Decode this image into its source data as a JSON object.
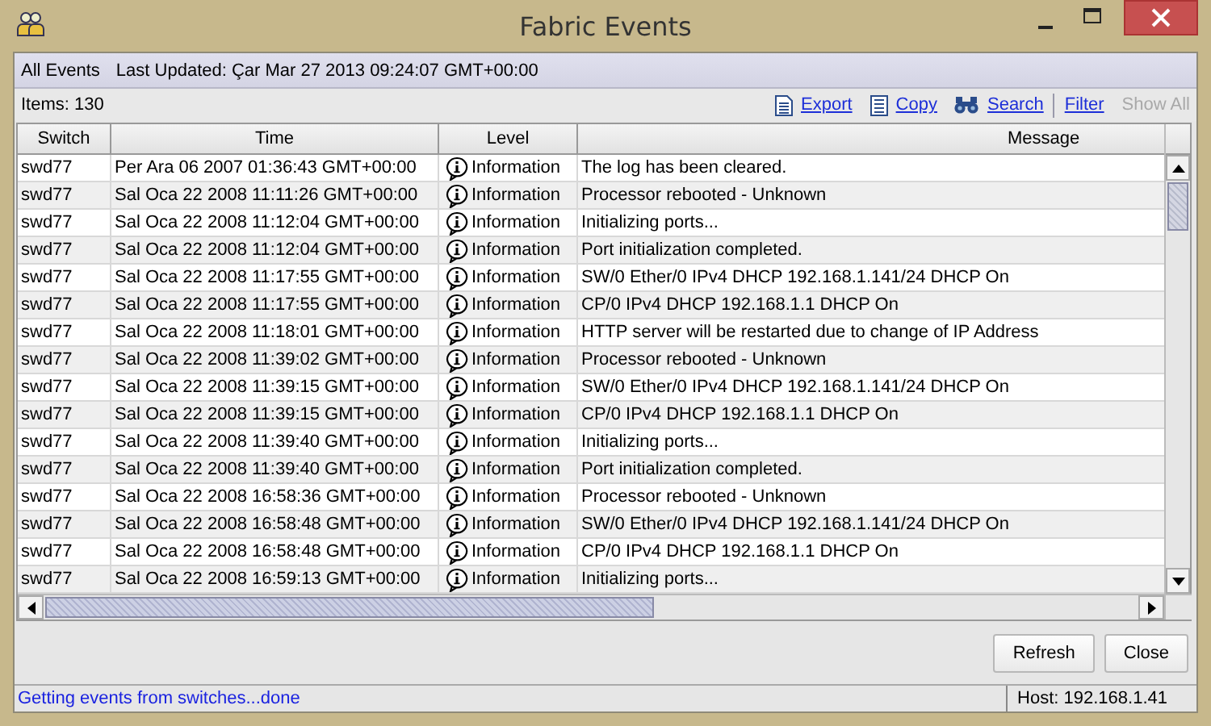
{
  "window": {
    "title": "Fabric Events"
  },
  "header": {
    "view": "All Events",
    "last_updated": "Last Updated: Çar Mar 27 2013 09:24:07 GMT+00:00"
  },
  "toolbar": {
    "items_count": "Items: 130",
    "actions": [
      {
        "kind": "export",
        "label": "Export",
        "disabled": false
      },
      {
        "kind": "copy",
        "label": "Copy",
        "disabled": false
      },
      {
        "kind": "search",
        "label": "Search",
        "disabled": false
      },
      {
        "kind": "filter",
        "label": "Filter",
        "disabled": false
      },
      {
        "kind": "show_all",
        "label": "Show All",
        "disabled": true
      }
    ]
  },
  "table": {
    "columns": [
      "Switch",
      "Time",
      "Level",
      "Message"
    ],
    "rows": [
      {
        "switch": "swd77",
        "time": "Per Ara 06 2007 01:36:43 GMT+00:00",
        "level": "Information",
        "message": "The log has been cleared."
      },
      {
        "switch": "swd77",
        "time": "Sal Oca 22 2008 11:11:26 GMT+00:00",
        "level": "Information",
        "message": "Processor rebooted - Unknown"
      },
      {
        "switch": "swd77",
        "time": "Sal Oca 22 2008 11:12:04 GMT+00:00",
        "level": "Information",
        "message": "Initializing ports..."
      },
      {
        "switch": "swd77",
        "time": "Sal Oca 22 2008 11:12:04 GMT+00:00",
        "level": "Information",
        "message": "Port initialization completed."
      },
      {
        "switch": "swd77",
        "time": "Sal Oca 22 2008 11:17:55 GMT+00:00",
        "level": "Information",
        "message": "SW/0 Ether/0 IPv4 DHCP 192.168.1.141/24 DHCP On"
      },
      {
        "switch": "swd77",
        "time": "Sal Oca 22 2008 11:17:55 GMT+00:00",
        "level": "Information",
        "message": "CP/0 IPv4 DHCP 192.168.1.1 DHCP On"
      },
      {
        "switch": "swd77",
        "time": "Sal Oca 22 2008 11:18:01 GMT+00:00",
        "level": "Information",
        "message": "HTTP server will be restarted due to change of IP Address"
      },
      {
        "switch": "swd77",
        "time": "Sal Oca 22 2008 11:39:02 GMT+00:00",
        "level": "Information",
        "message": "Processor rebooted - Unknown"
      },
      {
        "switch": "swd77",
        "time": "Sal Oca 22 2008 11:39:15 GMT+00:00",
        "level": "Information",
        "message": "SW/0 Ether/0 IPv4 DHCP 192.168.1.141/24 DHCP On"
      },
      {
        "switch": "swd77",
        "time": "Sal Oca 22 2008 11:39:15 GMT+00:00",
        "level": "Information",
        "message": "CP/0 IPv4 DHCP 192.168.1.1 DHCP On"
      },
      {
        "switch": "swd77",
        "time": "Sal Oca 22 2008 11:39:40 GMT+00:00",
        "level": "Information",
        "message": "Initializing ports..."
      },
      {
        "switch": "swd77",
        "time": "Sal Oca 22 2008 11:39:40 GMT+00:00",
        "level": "Information",
        "message": "Port initialization completed."
      },
      {
        "switch": "swd77",
        "time": "Sal Oca 22 2008 16:58:36 GMT+00:00",
        "level": "Information",
        "message": "Processor rebooted - Unknown"
      },
      {
        "switch": "swd77",
        "time": "Sal Oca 22 2008 16:58:48 GMT+00:00",
        "level": "Information",
        "message": "SW/0 Ether/0 IPv4 DHCP 192.168.1.141/24 DHCP On"
      },
      {
        "switch": "swd77",
        "time": "Sal Oca 22 2008 16:58:48 GMT+00:00",
        "level": "Information",
        "message": "CP/0 IPv4 DHCP 192.168.1.1 DHCP On"
      },
      {
        "switch": "swd77",
        "time": "Sal Oca 22 2008 16:59:13 GMT+00:00",
        "level": "Information",
        "message": "Initializing ports..."
      }
    ]
  },
  "buttons": [
    "Refresh",
    "Close"
  ],
  "status_bar": {
    "message": "Getting events from switches...done",
    "host": "Host: 192.168.1.41"
  }
}
